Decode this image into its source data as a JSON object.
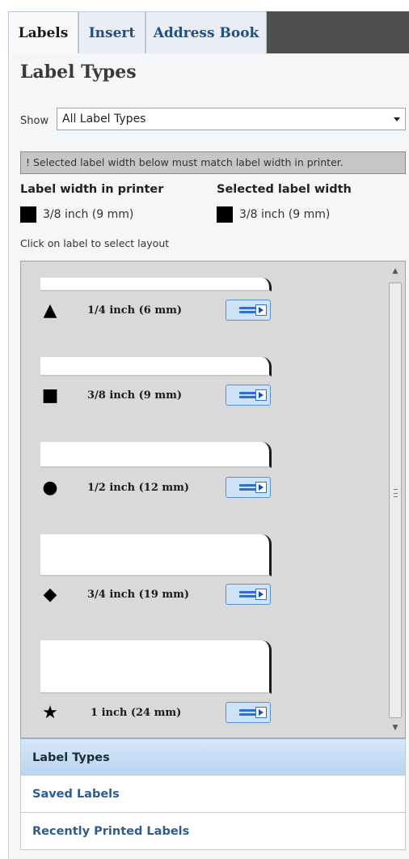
{
  "tabs": [
    {
      "label": "Labels",
      "active": true
    },
    {
      "label": "Insert",
      "active": false
    },
    {
      "label": "Address Book",
      "active": false
    }
  ],
  "section_title": "Label Types",
  "show": {
    "label": "Show",
    "selected": "All Label Types"
  },
  "warning": "! Selected label width below must match label width in printer.",
  "printer_width": {
    "heading": "Label width in printer",
    "value": "3/8 inch (9 mm)"
  },
  "selected_width": {
    "heading": "Selected label width",
    "value": "3/8 inch (9 mm)"
  },
  "hint": "Click on label to select layout",
  "labels": [
    {
      "size": "1/4 inch (6 mm)",
      "shape": "triangle"
    },
    {
      "size": "3/8 inch (9 mm)",
      "shape": "square"
    },
    {
      "size": "1/2 inch (12 mm)",
      "shape": "circle"
    },
    {
      "size": "3/4 inch (19 mm)",
      "shape": "diamond"
    },
    {
      "size": "1 inch (24 mm)",
      "shape": "star"
    }
  ],
  "nav": [
    {
      "label": "Label Types",
      "active": true
    },
    {
      "label": "Saved Labels",
      "active": false
    },
    {
      "label": "Recently Printed Labels",
      "active": false
    }
  ],
  "colors": {
    "accent": "#1f4f85",
    "nav_active": "#b9d5ef",
    "list_bg": "#d9d9d9"
  }
}
